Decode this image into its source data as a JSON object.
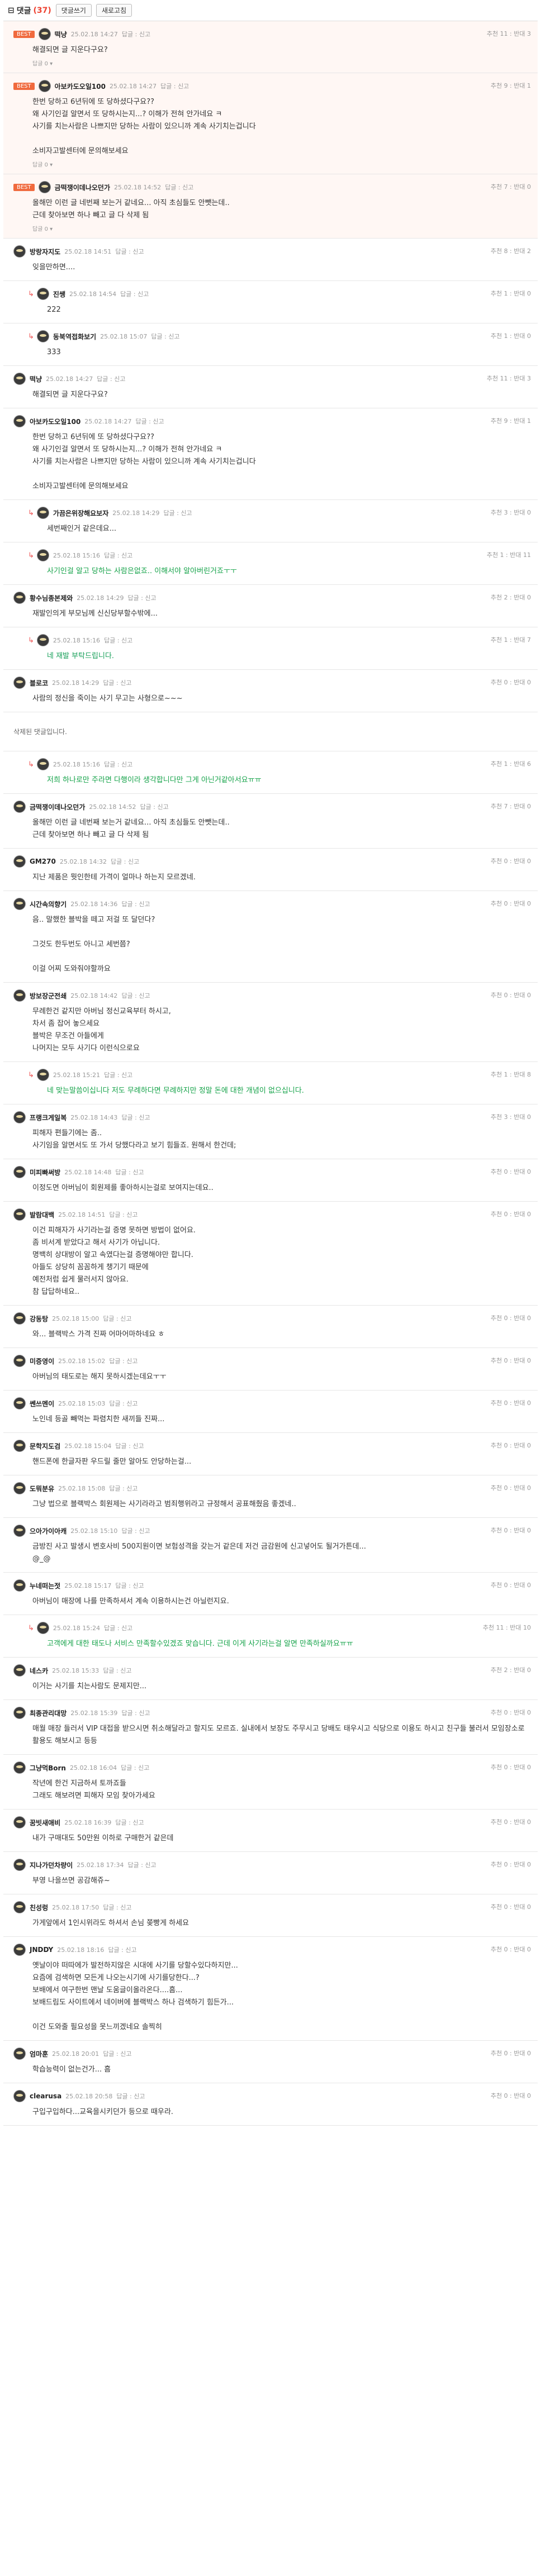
{
  "header": {
    "title": "댓글",
    "count": "(37)",
    "btn1": "댓글쓰기",
    "btn2": "새로고침"
  },
  "deleted": "삭제된 댓글입니다.",
  "comments": [
    {
      "best": true,
      "badge": "BEST",
      "nick": "떡냥",
      "date": "25.02.18 14:27",
      "meta": "답글 : 신고",
      "votes": "추천 11 : 반대 3",
      "body": "해결되면 글 지운다구요?",
      "replyLabel": "답글 0 ▾"
    },
    {
      "best": true,
      "badge": "BEST",
      "nick": "아보카도오일100",
      "date": "25.02.18 14:27",
      "meta": "답글 : 신고",
      "votes": "추천 9 : 반대 1",
      "body": "한번 당하고 6년뒤에 또 당하셨다구요??\n왜 사기인걸 알면서 또 당하시는지...? 이해가 전혀 안가네요 ㅋ\n사기를 치는사람은 나쁘지만 당하는 사람이 있으니까 계속 사기치는겁니다\n\n소비자고발센터에 문의해보세요",
      "replyLabel": "답글 0 ▾"
    },
    {
      "best": true,
      "badge": "BEST",
      "nick": "금떡쟁이데나오던가",
      "date": "25.02.18 14:52",
      "meta": "답글 : 신고",
      "votes": "추천 7 : 반대 0",
      "body": "올해만 이런 글 네번째 보는거 같네요... 아직 초심들도 안뺏는데..\n근데 찾아보면 하나 빼고 글 다 삭제 됨",
      "replyLabel": "답글 0 ▾"
    },
    {
      "nick": "방랑자지도",
      "date": "25.02.18 14:51",
      "meta": "답글 : 신고",
      "votes": "추천 8 : 반대 2",
      "body": "잊을만하면...."
    },
    {
      "reply": true,
      "nick": "진쌩",
      "date": "25.02.18 14:54",
      "meta": "답글 : 신고",
      "votes": "추천 1 : 반대 0",
      "body": "222"
    },
    {
      "reply": true,
      "nick": "동북역접화보기",
      "date": "25.02.18 15:07",
      "meta": "답글 : 신고",
      "votes": "추천 1 : 반대 0",
      "body": "333"
    },
    {
      "nick": "떡냥",
      "date": "25.02.18 14:27",
      "meta": "답글 : 신고",
      "votes": "추천 11 : 반대 3",
      "body": "해결되면 글 지운다구요?"
    },
    {
      "nick": "아보카도오일100",
      "date": "25.02.18 14:27",
      "meta": "답글 : 신고",
      "votes": "추천 9 : 반대 1",
      "body": "한번 당하고 6년뒤에 또 당하셨다구요??\n왜 사기인걸 알면서 또 당하시는지...? 이해가 전혀 안가네요 ㅋ\n사기를 치는사람은 나쁘지만 당하는 사람이 있으니까 계속 사기치는겁니다\n\n소비자고발센터에 문의해보세요"
    },
    {
      "reply": true,
      "nick": "가끔은위장해요보자",
      "date": "25.02.18 14:29",
      "meta": "답글 : 신고",
      "votes": "추천 3 : 반대 0",
      "body": "세번째인거 같은데요..."
    },
    {
      "reply": true,
      "nick": "",
      "date": "25.02.18 15:16",
      "meta": "답글 : 신고",
      "votes": "추천 1 : 반대 11",
      "body": "사기인걸 알고 당하는 사람은없죠.. 이해서야 알아버린거죠ㅜㅜ",
      "red": true
    },
    {
      "nick": "황수님종본제와",
      "date": "25.02.18 14:29",
      "meta": "답글 : 신고",
      "votes": "추천 2 : 반대 0",
      "body": "재발인의게 부모님께 신신당부할수밖에..."
    },
    {
      "reply": true,
      "nick": "",
      "date": "25.02.18 15:16",
      "meta": "답글 : 신고",
      "votes": "추천 1 : 반대 7",
      "body": "네 재발 부탁드립니다.",
      "green": true
    },
    {
      "nick": "블로코",
      "date": "25.02.18 14:29",
      "meta": "답글 : 신고",
      "votes": "추천 0 : 반대 0",
      "body": "사람의 정신을 죽이는 사기 무고는 사형으로~~~"
    }
  ],
  "comments2": [
    {
      "reply": true,
      "nick": "",
      "date": "25.02.18 15:16",
      "meta": "답글 : 신고",
      "votes": "추천 1 : 반대 6",
      "body": "저희 하나로만 주라면 다행이라 생각합니다만 그게 아닌거같아서요ㅠㅠ",
      "red": true
    },
    {
      "nick": "금떡쟁이데나오던가",
      "date": "25.02.18 14:52",
      "meta": "답글 : 신고",
      "votes": "추천 7 : 반대 0",
      "body": "올해만 이런 글 네번째 보는거 같네요... 아직 초심들도 안뺏는데..\n근데 찾아보면 하나 빼고 글 다 삭제 됨"
    },
    {
      "nick": "GM270",
      "date": "25.02.18 14:32",
      "meta": "답글 : 신고",
      "votes": "추천 0 : 반대 0",
      "body": "지난 제품은 뭣인한테 가격이 얼마나 하는지 모르겠네."
    },
    {
      "nick": "시간속의향기",
      "date": "25.02.18 14:36",
      "meta": "답글 : 신고",
      "votes": "추천 0 : 반대 0",
      "body": "음.. 말했한 블박을 떼고 저걸 또 달던다?\n\n그것도 한두번도 아니고 세번쯤?\n\n이걸 어찌 도와줘야할까요"
    },
    {
      "nick": "방보장군전쇄",
      "date": "25.02.18 14:42",
      "meta": "답글 : 신고",
      "votes": "추천 0 : 반대 0",
      "body": "무례한건 같지만 아버님 정신교육부터 하시고,\n차서 좀 잡어 놓으세요\n블박은 무조건 아들에게\n나머지는 모두 사기다 이런식으로요"
    },
    {
      "reply": true,
      "nick": "",
      "date": "25.02.18 15:21",
      "meta": "답글 : 신고",
      "votes": "추천 1 : 반대 8",
      "body": "네 맞는말씀이십니다 저도 무례하다면 무례하지만 정말 돈에 대한 개념이 없으십니다.",
      "red": true
    },
    {
      "nick": "프랭크게일복",
      "date": "25.02.18 14:43",
      "meta": "답글 : 신고",
      "votes": "추천 3 : 반대 0",
      "body": "피해자 편들기에는 좀..\n사기임을 알면서도 또 가서 당했다라고 보기 힘들죠. 원해서 한건데;"
    },
    {
      "nick": "미피빠써방",
      "date": "25.02.18 14:48",
      "meta": "답글 : 신고",
      "votes": "추천 0 : 반대 0",
      "body": "이정도면 아버님이 회원제를 좋아하시는걸로 보여지는데요.."
    },
    {
      "nick": "발람대백",
      "date": "25.02.18 14:51",
      "meta": "답글 : 신고",
      "votes": "추천 0 : 반대 0",
      "body": "이건 피해자가 사기라는걸 증명 못하면 방법이 없어요.\n좀 비서계 받았다고 해서 사기가 아닙니다.\n명백히 상대방이 알고 속였다는걸 증명해야만 합니다.\n아들도 상당히 꼼꼼하게 챙기기 때문에\n예전처럼 쉽게 물러서지 않아요.\n참 답답하네요.."
    },
    {
      "nick": "강동탕",
      "date": "25.02.18 15:00",
      "meta": "답글 : 신고",
      "votes": "추천 0 : 반대 0",
      "body": "와... 블랙박스 가격 진짜 어마어마하네요 ㅎ"
    },
    {
      "nick": "미증영이",
      "date": "25.02.18 15:02",
      "meta": "답글 : 신고",
      "votes": "추천 0 : 반대 0",
      "body": "아버님의 태도로는 해지 못하시겠는데요ㅜㅜ"
    },
    {
      "nick": "쎈쓰멘이",
      "date": "25.02.18 15:03",
      "meta": "답글 : 신고",
      "votes": "추천 0 : 반대 0",
      "body": "노인네 등골 빼먹는 파렴치한 새끼들 진짜..."
    },
    {
      "nick": "문학지도검",
      "date": "25.02.18 15:04",
      "meta": "답글 : 신고",
      "votes": "추천 0 : 반대 0",
      "body": "핸드폰에 한글자판 우드릴 줄만 알아도 안당하는걸..."
    },
    {
      "nick": "도뭐분유",
      "date": "25.02.18 15:08",
      "meta": "답글 : 신고",
      "votes": "추천 0 : 반대 0",
      "body": "그냥 법으로 블랙박스 회원제는 사기라라고 범죄행위라고 규정해서 공표해줬음 좋겠네.."
    },
    {
      "nick": "으아가이아캐",
      "date": "25.02.18 15:10",
      "meta": "답글 : 신고",
      "votes": "추천 0 : 반대 0",
      "body": "금방진 사고 발생시 변호사비 500지원이면 보험성격을 갖는거 같은데 저건 금감원에 신고넣어도 될거가튼데...\n@_@"
    },
    {
      "nick": "누네떠는젓",
      "date": "25.02.18 15:17",
      "meta": "답글 : 신고",
      "votes": "추천 0 : 반대 0",
      "body": "아버님이 매장에 나를 만족하셔서 계속 이용하시는건 아닐런지요."
    },
    {
      "reply": true,
      "nick": "",
      "date": "25.02.18 15:24",
      "meta": "답글 : 신고",
      "votes": "추천 11 : 반대 10",
      "body": "고객에게 대한 태도나 서비스 만족할수있겠죠 맞습니다. 근데 이게 사기라는걸 알면 만족하실까요ㅠㅠ",
      "red": true
    },
    {
      "nick": "네스카",
      "date": "25.02.18 15:33",
      "meta": "답글 : 신고",
      "votes": "추천 2 : 반대 0",
      "body": "이거는 사기를 치는사람도 문제지만..."
    },
    {
      "nick": "최종관리대망",
      "date": "25.02.18 15:39",
      "meta": "답글 : 신고",
      "votes": "추천 0 : 반대 0",
      "body": "매월 매장 들러서 VIP 대접을 받으시면 취소해달라고 할지도 모르죠. 실내에서 보장도 주무시고 당배도 태우시고 식당으로 이용도 하시고 친구들 불러서 모임장소로 활용도 해보시고 등등"
    },
    {
      "nick": "그냥먹Born",
      "date": "25.02.18 16:04",
      "meta": "답글 : 신고",
      "votes": "추천 0 : 반대 0",
      "body": "작년에 한건 지금하셔 토까죠들\n그래도 해보려면 피해자 모임 찾아가세요"
    },
    {
      "nick": "꿈빗새애비",
      "date": "25.02.18 16:39",
      "meta": "답글 : 신고",
      "votes": "추천 0 : 반대 0",
      "body": "내가 구매대도 50만원 이하로 구매한거 같은데"
    },
    {
      "nick": "지나가던차량이",
      "date": "25.02.18 17:34",
      "meta": "답글 : 신고",
      "votes": "추천 0 : 반대 0",
      "body": "부영 나을쓰면 공감해쥬~"
    },
    {
      "nick": "친성렁",
      "date": "25.02.18 17:50",
      "meta": "답글 : 신고",
      "votes": "추천 0 : 반대 0",
      "body": "가게앞에서 1인시위라도 하셔서 손님 쫒빵게 하세요"
    },
    {
      "nick": "JNDDY",
      "date": "25.02.18 18:16",
      "meta": "답글 : 신고",
      "votes": "추천 0 : 반대 0",
      "body": "옛날이야 떠따에가 발전하지않은 시대에 사기를 당할수있다하지만...\n요즘에 검색하면 모든게 나오는시기에 사기를당한다...?\n보배에서 여구한번 맨날 도움글이올라온다....흠...\n보배드림도 사이트에서 네이버에 블랙박스 하나 검색하기 힘든가...\n\n이건 도와줄 필요성을 못느끼겠네요 솔찍히"
    },
    {
      "nick": "엄마훈",
      "date": "25.02.18 20:01",
      "meta": "답글 : 신고",
      "votes": "추천 0 : 반대 0",
      "body": "학습능력이 없는건가... 흠"
    },
    {
      "nick": "clearusa",
      "date": "25.02.18 20:58",
      "meta": "답글 : 신고",
      "votes": "추천 0 : 반대 0",
      "body": "구입구입하다...교육을시키던가 등으로 때우라."
    }
  ]
}
